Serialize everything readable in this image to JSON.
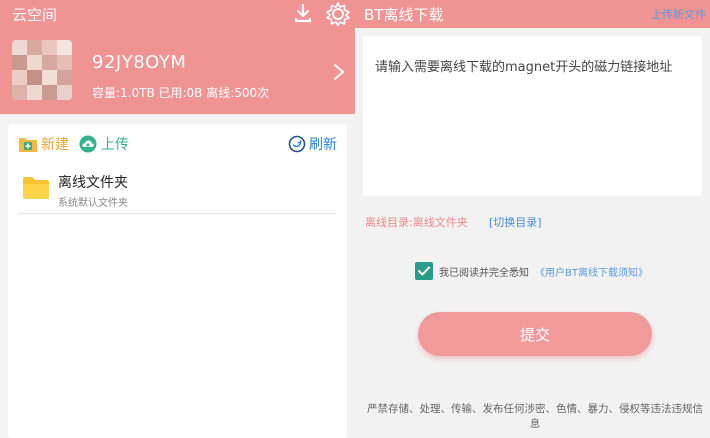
{
  "left": {
    "title": "云空间",
    "user": {
      "name": "92JY8OYM",
      "info": "容量:1.0TB 已用:0B 离线:500次"
    },
    "toolbar": {
      "new_label": "新建",
      "upload_label": "上传",
      "refresh_label": "刷新"
    },
    "files": [
      {
        "name": "离线文件夹",
        "desc": "系统默认文件夹"
      }
    ]
  },
  "right": {
    "title": "BT离线下载",
    "upload_link": "上传新文件",
    "magnet_placeholder": "请输入需要离线下载的magnet开头的磁力链接地址",
    "dir_label": "离线目录:离线文件夹",
    "dir_switch": "[切换目录]",
    "agree_text": "我已阅读并完全悉知",
    "agree_link": "《用户BT离线下载须知》",
    "submit_label": "提交",
    "warning": "严禁存储、处理、传输、发布任何涉密、色情、暴力、侵权等违法违规信息"
  },
  "colors": {
    "header": "#ef9393",
    "accent_blue": "#4a8dd8",
    "checkbox": "#2a9d8a",
    "new_orange": "#f0a338",
    "upload_green": "#34b38a"
  },
  "icons": [
    "download-icon",
    "gear-icon",
    "chevron-right-icon",
    "new-folder-icon",
    "upload-cloud-icon",
    "refresh-icon",
    "folder-icon",
    "check-icon"
  ]
}
